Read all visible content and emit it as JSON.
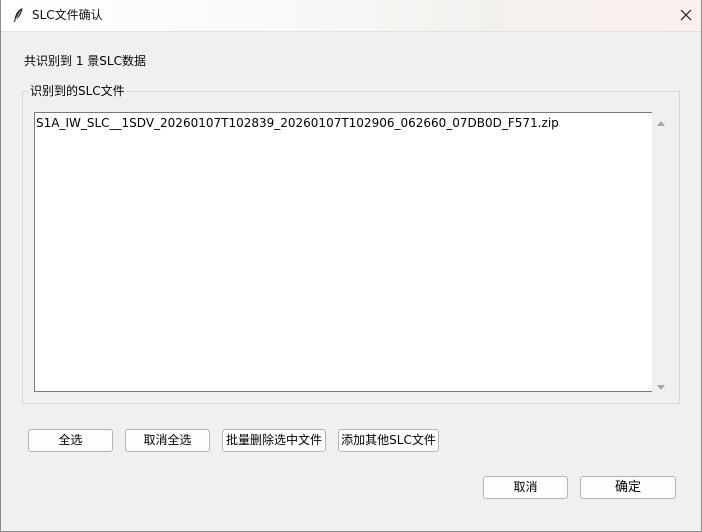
{
  "window": {
    "title": "SLC文件确认"
  },
  "summary": {
    "count_text": "共识别到 1 景SLC数据"
  },
  "file_group": {
    "legend": "识别到的SLC文件",
    "files": [
      "S1A_IW_SLC__1SDV_20260107T102839_20260107T102906_062660_07DB0D_F571.zip"
    ]
  },
  "actions": {
    "select_all": "全选",
    "deselect_all": "取消全选",
    "batch_delete": "批量删除选中文件",
    "add_other": "添加其他SLC文件"
  },
  "footer": {
    "cancel": "取消",
    "ok": "确定"
  },
  "icons": {
    "title": "feather-icon",
    "close": "close-icon",
    "scroll_up": "scroll-up-arrow-icon",
    "scroll_down": "scroll-down-arrow-icon"
  },
  "colors": {
    "background": "#f0f0f0",
    "list_background": "#ffffff",
    "button_face": "#fdfdfd"
  }
}
